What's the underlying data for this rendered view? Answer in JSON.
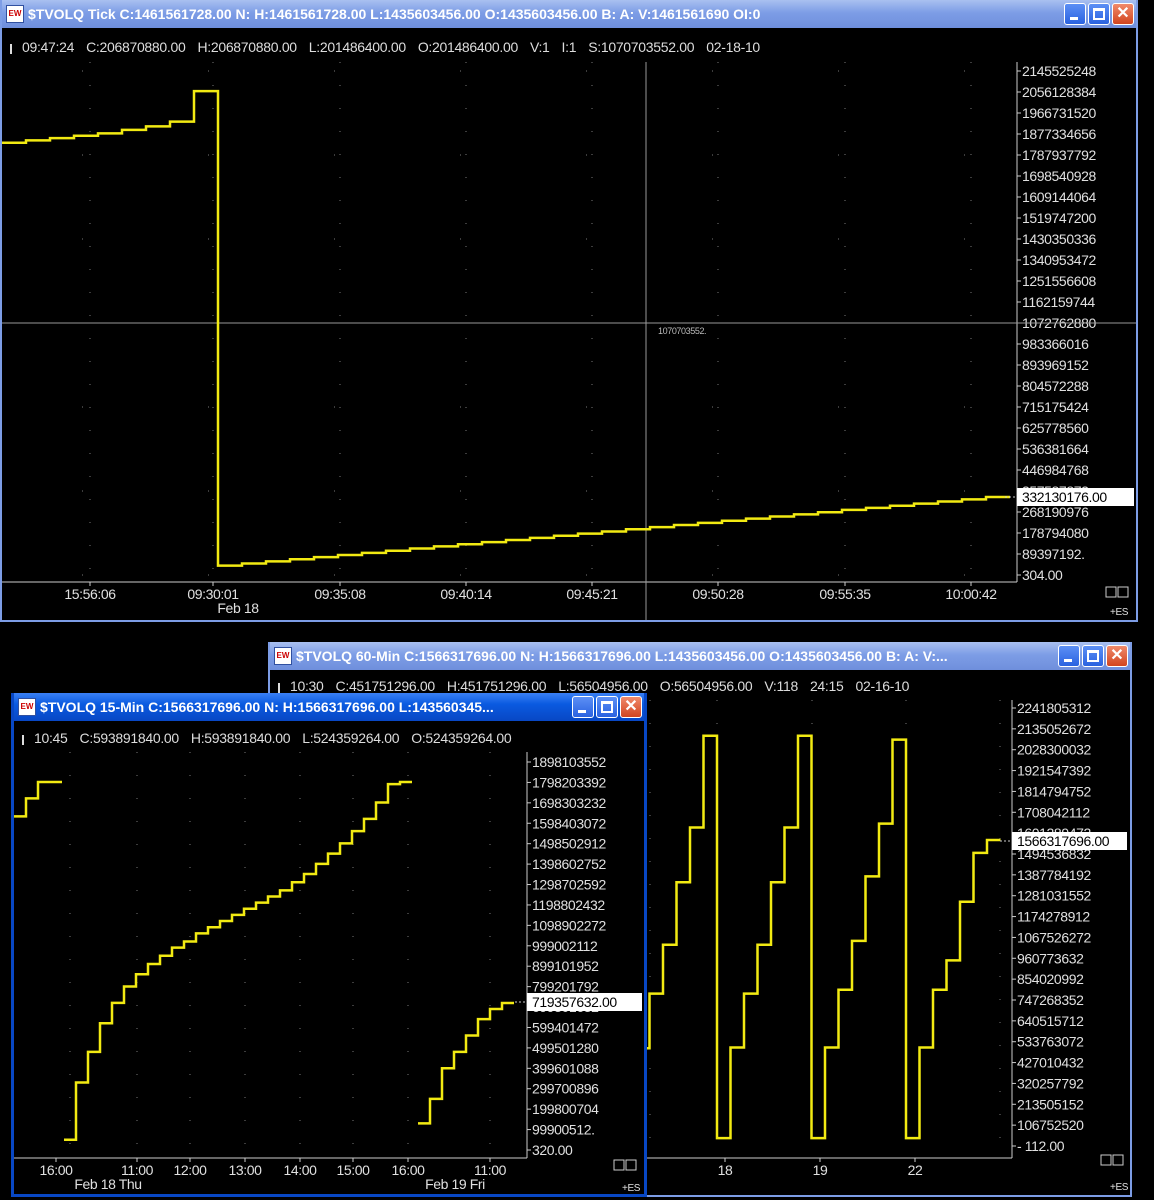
{
  "colors": {
    "line": "#f2ea12",
    "background": "#000000",
    "axis": "#cccccc",
    "active_title": "#0a5ae0",
    "inactive_title": "#7d9de6"
  },
  "windows": {
    "tick": {
      "title": "$TVOLQ Tick C:1461561728.00 N: H:1461561728.00 L:1435603456.00 O:1435603456.00 B: A: V:1461561690 OI:0",
      "info": [
        "09:47:24",
        "C:206870880.00",
        "H:206870880.00",
        "L:201486400.00",
        "O:201486400.00",
        "V:1",
        "I:1",
        "S:1070703552.00",
        "02-18-10"
      ],
      "y_ticks": [
        "2145525248",
        "2056128384",
        "1966731520",
        "1877334656",
        "1787937792",
        "1698540928",
        "1609144064",
        "1519747200",
        "1430350336",
        "1340953472",
        "1251556608",
        "1162159744",
        "1072762880",
        "983366016",
        "893969152",
        "804572288",
        "715175424",
        "625778560",
        "536381664",
        "446984768",
        "357587872",
        "268190976",
        "178794080",
        "89397192.",
        "304.00"
      ],
      "x_ticks": [
        "15:56:06",
        "09:30:01",
        "09:35:08",
        "09:40:14",
        "09:45:21",
        "09:50:28",
        "09:55:35",
        "10:00:42"
      ],
      "date_labels": [
        "Feb 18"
      ],
      "current_value": "332130176.00",
      "crosshair_value": "1070703552.",
      "footer": "+ES"
    },
    "min60": {
      "title": "$TVOLQ 60-Min C:1566317696.00 N: H:1566317696.00 L:1435603456.00 O:1435603456.00 B: A: V:...",
      "info": [
        "10:30",
        "C:451751296.00",
        "H:451751296.00",
        "L:56504956.00",
        "O:56504956.00",
        "V:118",
        "24:15",
        "02-16-10"
      ],
      "y_ticks": [
        "2241805312",
        "2135052672",
        "2028300032",
        "1921547392",
        "1814794752",
        "1708042112",
        "1601289472",
        "1494536832",
        "1387784192",
        "1281031552",
        "1174278912",
        "1067526272",
        "960773632",
        "854020992",
        "747268352",
        "640515712",
        "533763072",
        "427010432",
        "320257792",
        "213505152",
        "106752520",
        "- 112.00"
      ],
      "x_ticks": [
        "18",
        "19",
        "22"
      ],
      "date_labels": [],
      "current_value": "1566317696.00",
      "footer": "+ES"
    },
    "min15": {
      "title": "$TVOLQ 15-Min C:1566317696.00 N: H:1566317696.00 L:143560345...",
      "info": [
        "10:45",
        "C:593891840.00",
        "H:593891840.00",
        "L:524359264.00",
        "O:524359264.00"
      ],
      "y_ticks": [
        "1898103552",
        "1798203392",
        "1698303232",
        "1598403072",
        "1498502912",
        "1398602752",
        "1298702592",
        "1198802432",
        "1098902272",
        "999002112",
        "899101952",
        "799201792",
        "699301632",
        "599401472",
        "499501280",
        "399601088",
        "299700896",
        "199800704",
        "99900512.",
        "320.00"
      ],
      "x_ticks": [
        "16:00",
        "11:00",
        "12:00",
        "13:00",
        "14:00",
        "15:00",
        "16:00",
        "11:00"
      ],
      "date_labels": [
        "Feb 18 Thu",
        "Feb 19 Fri"
      ],
      "current_value": "719357632.00",
      "footer": "+ES"
    }
  },
  "chart_data": [
    {
      "type": "line",
      "window": "tick",
      "style": "step",
      "ylim": [
        304,
        2145525248
      ],
      "grid": true,
      "series": [
        {
          "values": [
            1840000000,
            1850000000,
            1860000000,
            1870000000,
            1880000000,
            1895000000,
            1910000000,
            1930000000,
            2060000000,
            40000000,
            49000000,
            58000000,
            67000000,
            76000000,
            85000000,
            94000000,
            103000000,
            113000000,
            122000000,
            131000000,
            140000000,
            149000000,
            158000000,
            167000000,
            176000000,
            185000000,
            195000000,
            204000000,
            213000000,
            222000000,
            231000000,
            240000000,
            249000000,
            258000000,
            267000000,
            277000000,
            286000000,
            295000000,
            304000000,
            313000000,
            322000000,
            332130176
          ]
        }
      ]
    },
    {
      "type": "line",
      "window": "min60",
      "style": "step",
      "ylim": [
        -112,
        2241805312
      ],
      "grid": true,
      "series": [
        {
          "values": [
            60000000,
            500000000,
            780000000,
            1030000000,
            1350000000,
            1630000000,
            2100000000,
            40000000,
            504000000,
            780000000,
            1030000000,
            1350000000,
            1630000000,
            2100000000,
            40000000,
            504000000,
            800000000,
            1050000000,
            1380000000,
            1650000000,
            2080000000,
            40000000,
            504000000,
            800000000,
            950000000,
            1250000000,
            1500000000,
            1566317696
          ]
        }
      ]
    },
    {
      "type": "line",
      "window": "min15",
      "style": "step",
      "ylim": [
        320,
        1898103552
      ],
      "grid": true,
      "series": [
        {
          "values": [
            1632000000,
            1720000000,
            1800000000,
            1800000000
          ]
        },
        {
          "values": [
            50000000,
            330000000,
            480000000,
            620000000,
            720000000,
            800000000,
            860000000,
            910000000,
            950000000,
            990000000,
            1020000000,
            1060000000,
            1090000000,
            1120000000,
            1150000000,
            1180000000,
            1210000000,
            1240000000,
            1270000000,
            1310000000,
            1350000000,
            1400000000,
            1450000000,
            1500000000,
            1560000000,
            1620000000,
            1700000000,
            1790000000,
            1800000000
          ]
        },
        {
          "values": [
            130000000,
            250000000,
            400000000,
            480000000,
            560000000,
            640000000,
            690000000,
            719357632
          ]
        }
      ]
    }
  ]
}
